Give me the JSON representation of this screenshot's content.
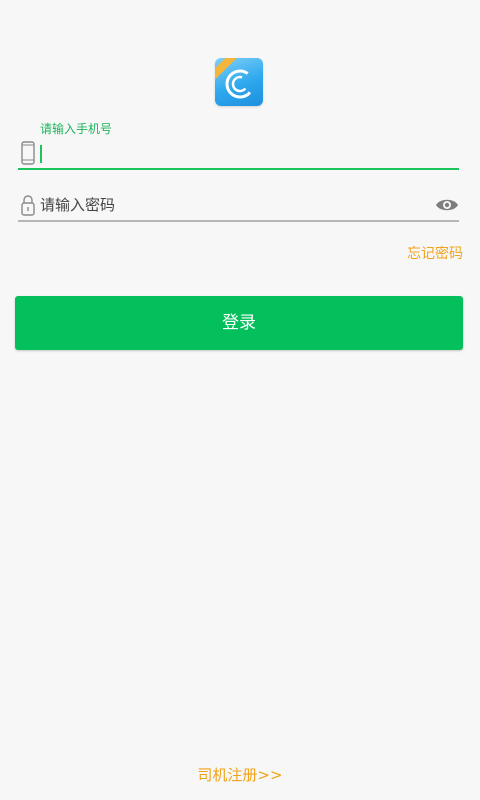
{
  "logo": {
    "icon": "app-logo-icon",
    "colors": {
      "blue": "#2ea8ee",
      "ribbon": "#f3b53a"
    }
  },
  "phone": {
    "label": "请输入手机号",
    "value": "",
    "icon": "phone-icon"
  },
  "password": {
    "placeholder": "请输入密码",
    "value": "",
    "icon": "lock-icon",
    "toggle_icon": "eye-icon"
  },
  "forgot_password": "忘记密码",
  "login_button": "登录",
  "register_link": "司机注册>>",
  "colors": {
    "accent": "#04c05c",
    "link": "#f0a31a",
    "background": "#f7f7f7"
  }
}
